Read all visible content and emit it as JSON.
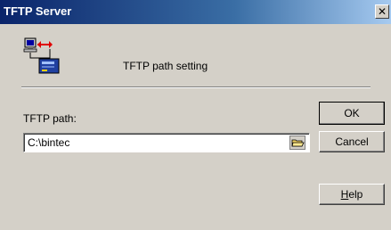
{
  "window": {
    "title": "TFTP Server",
    "close_glyph": "✕"
  },
  "header": {
    "title": "TFTP path setting",
    "icon": "network-computer-transfer-icon"
  },
  "form": {
    "path_label": "TFTP path:",
    "path_value": "C:\\bintec",
    "browse_icon": "folder-open-icon"
  },
  "buttons": {
    "ok": "OK",
    "cancel": "Cancel",
    "help_accel": "H",
    "help_rest": "elp"
  },
  "colors": {
    "face": "#d4d0c8",
    "title_start": "#0a246a",
    "title_end": "#a6caf0"
  }
}
